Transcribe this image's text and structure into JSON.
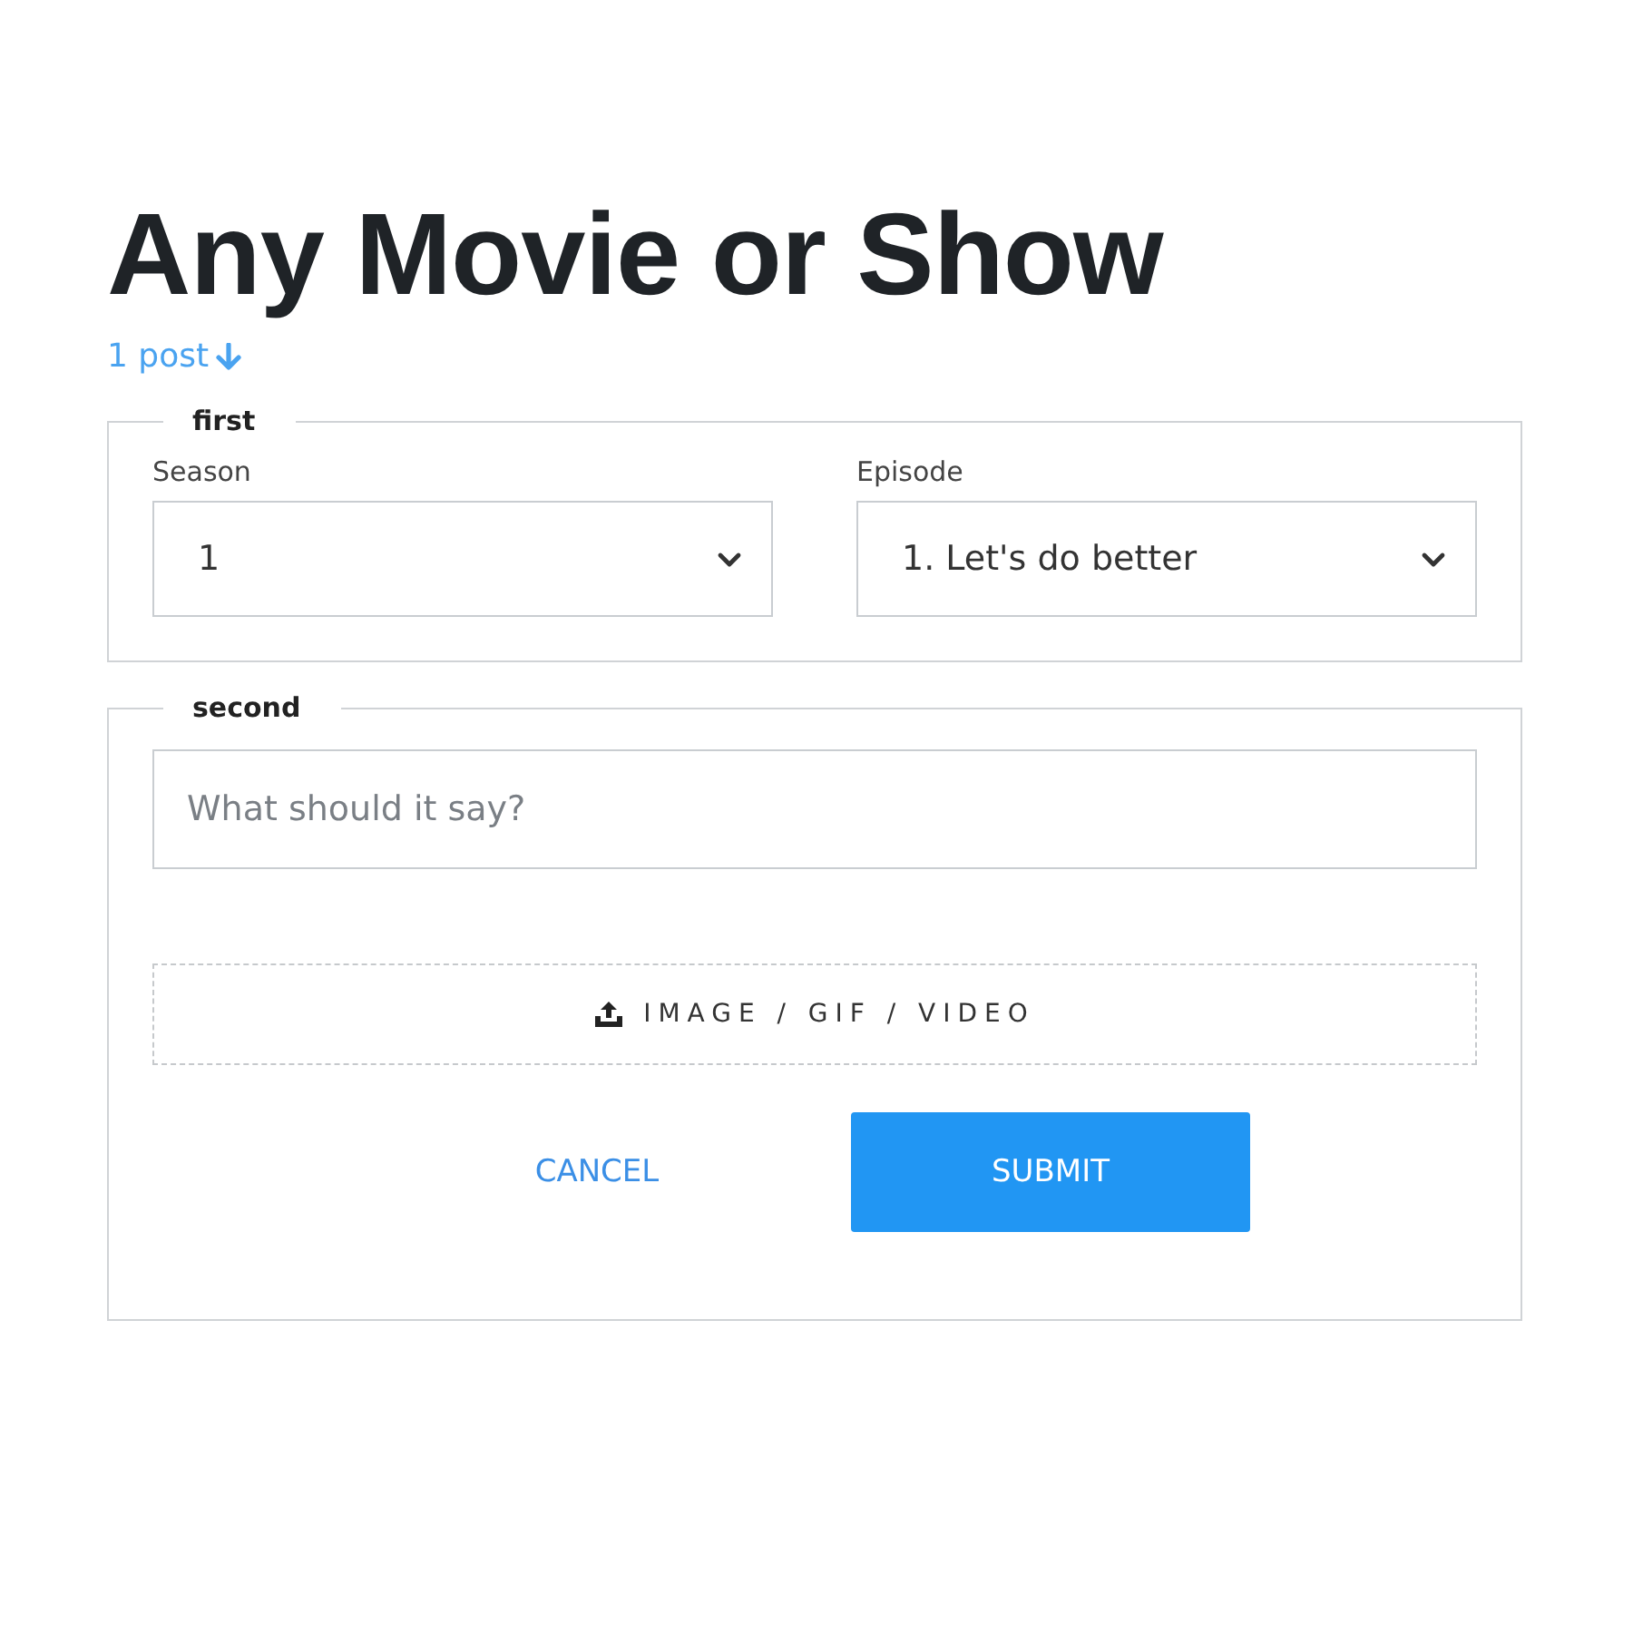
{
  "title": "Any Movie or Show",
  "post_link": "1 post",
  "sections": [
    {
      "legend": "first",
      "kind": "selects",
      "fields": [
        {
          "label": "Season",
          "value": "1"
        },
        {
          "label": "Episode",
          "value": "1. Let's do better"
        }
      ]
    },
    {
      "legend": "second",
      "kind": "compose",
      "placeholder": "What should it say?",
      "upload": "IMAGE / GIF / VIDEO",
      "buttons": [
        {
          "label": "CANCEL",
          "kind": "text"
        },
        {
          "label": "SUBMIT",
          "kind": "primary"
        }
      ]
    }
  ]
}
